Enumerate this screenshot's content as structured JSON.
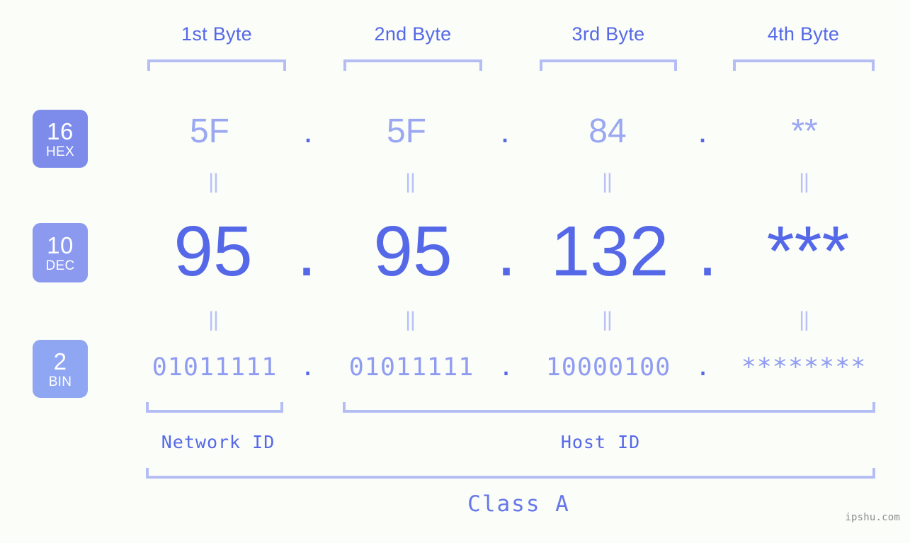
{
  "background_color": "#fbfdf8",
  "accent_color": "#5568e8",
  "muted_accent_color": "#9aa8f2",
  "bracket_color": "#b5bdf5",
  "byte_headers": [
    {
      "label": "1st Byte"
    },
    {
      "label": "2nd Byte"
    },
    {
      "label": "3rd Byte"
    },
    {
      "label": "4th Byte"
    }
  ],
  "bases": [
    {
      "number": "16",
      "name": "HEX",
      "color": "#7d8ceb"
    },
    {
      "number": "10",
      "name": "DEC",
      "color": "#8b99ef"
    },
    {
      "number": "2",
      "name": "BIN",
      "color": "#8fa6f2"
    }
  ],
  "rows": {
    "hex": {
      "values": [
        "5F",
        "5F",
        "84",
        "**"
      ],
      "separator": "."
    },
    "dec": {
      "values": [
        "95",
        "95",
        "132",
        "***"
      ],
      "separator": "."
    },
    "bin": {
      "values": [
        "01011111",
        "01011111",
        "10000100",
        "********"
      ],
      "separator": "."
    }
  },
  "equality_marks": {
    "symbol": "||",
    "count_per_row": 4
  },
  "id_labels": [
    {
      "label": "Network ID"
    },
    {
      "label": "Host ID"
    }
  ],
  "class_label": "Class A",
  "watermark": "ipshu.com"
}
